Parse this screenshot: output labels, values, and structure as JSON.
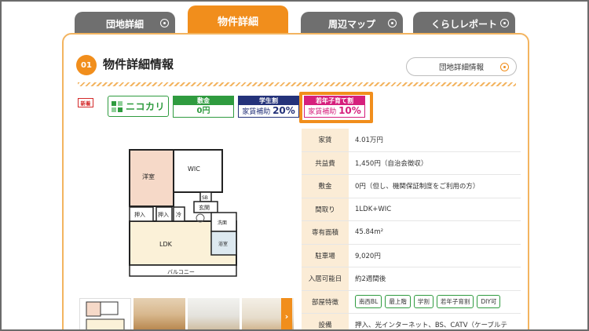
{
  "tabs": [
    {
      "label": "団地詳細",
      "active": false
    },
    {
      "label": "物件詳細",
      "active": true
    },
    {
      "label": "周辺マップ",
      "active": false
    },
    {
      "label": "くらしレポート",
      "active": false
    }
  ],
  "section": {
    "number": "01",
    "title": "物件詳細情報",
    "link_label": "団地詳細情報"
  },
  "badges": {
    "new": "新着",
    "niko_label": "ニコカリ",
    "shikikin": {
      "head": "敷金",
      "value": "0円"
    },
    "gakusei": {
      "head": "学生割",
      "value_prefix": "家賃補助",
      "value_big": "20%"
    },
    "jakunen": {
      "head": "若年子育て割",
      "value_prefix": "家賃補助",
      "value_big": "10%"
    }
  },
  "floorplan": {
    "rooms": [
      "洋室",
      "WIC",
      "SB",
      "玄関",
      "押入",
      "押入",
      "冷",
      "LDK",
      "洗面",
      "浴室",
      "バルコニー"
    ]
  },
  "thumbnails": {
    "next_icon": "›",
    "count": 4
  },
  "details": [
    {
      "label": "家賃",
      "value": "4.01万円"
    },
    {
      "label": "共益費",
      "value": "1,450円（自治会徴収）"
    },
    {
      "label": "敷金",
      "value": "0円（但し、機関保証制度をご利用の方）"
    },
    {
      "label": "間取り",
      "value": "1LDK+WIC"
    },
    {
      "label": "専有面積",
      "value": "45.84m²"
    },
    {
      "label": "駐車場",
      "value": "9,020円"
    },
    {
      "label": "入居可能日",
      "value": "約2週間後"
    },
    {
      "label": "部屋特徴",
      "tags": [
        "南西BL",
        "最上階",
        "学割",
        "若年子育割",
        "DIY可"
      ]
    },
    {
      "label": "設備",
      "value": "押入、光インターネット、BS、CATV（ケーブルテ"
    }
  ],
  "colors": {
    "accent": "#f18e1c",
    "tab_inactive": "#6f6f6f",
    "green": "#2f9b3f",
    "navy": "#24327a",
    "magenta": "#d61f7c"
  }
}
